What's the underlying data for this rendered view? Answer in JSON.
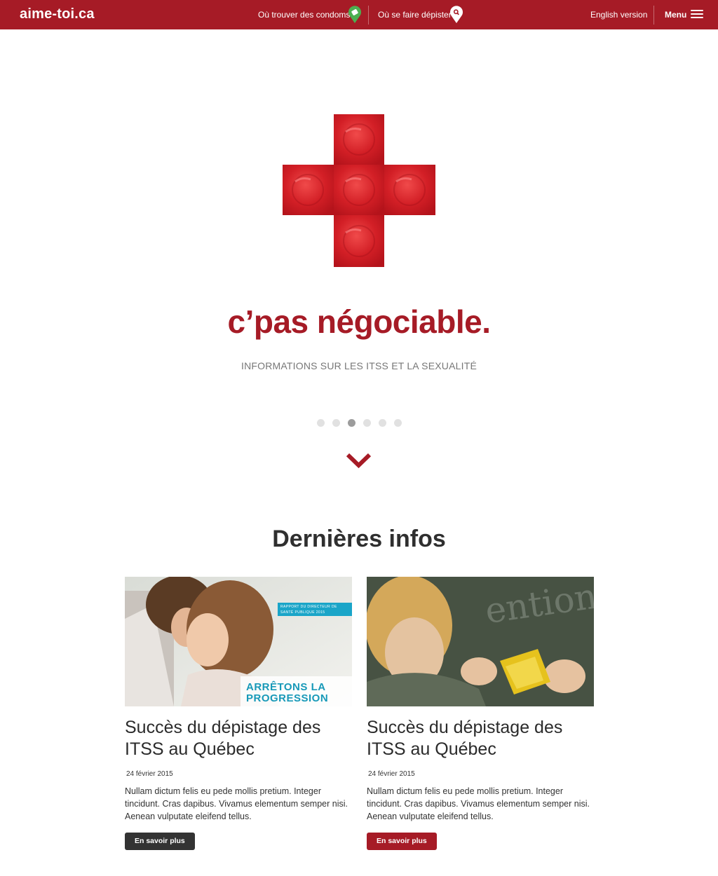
{
  "header": {
    "logo": "aime-toi.ca",
    "nav": {
      "condoms": "Où trouver des condoms",
      "depister": "Où se faire dépister",
      "english": "English version",
      "menu": "Menu"
    },
    "colors": {
      "bar": "#a61b26",
      "pin_condoms": "#4caf50"
    }
  },
  "hero": {
    "title": "c’pas négociable.",
    "subtitle": "INFORMATIONS SUR LES ITSS ET LA SEXUALITÉ",
    "carousel": {
      "count": 6,
      "active_index": 2
    }
  },
  "latest": {
    "title": "Dernières infos",
    "cards": [
      {
        "image_tag": "RAPPORT DU DIRECTEUR DE SANTÉ PUBLIQUE 2015",
        "image_banner_1": "ARRÊTONS LA",
        "image_banner_2": "PROGRESSION",
        "title": "Succès  du dépistage des ITSS au Québec",
        "date": "24 février 2015",
        "text": "Nullam dictum felis eu pede mollis pretium. Integer tincidunt. Cras dapibus. Vivamus elementum semper nisi. Aenean vulputate eleifend tellus.",
        "button": "En savoir plus"
      },
      {
        "title": "Succès  du dépistage des ITSS au Québec",
        "date": "24 février 2015",
        "text": "Nullam dictum felis eu pede mollis pretium. Integer tincidunt. Cras dapibus. Vivamus elementum semper nisi. Aenean vulputate eleifend tellus.",
        "button": "En savoir plus"
      }
    ]
  }
}
